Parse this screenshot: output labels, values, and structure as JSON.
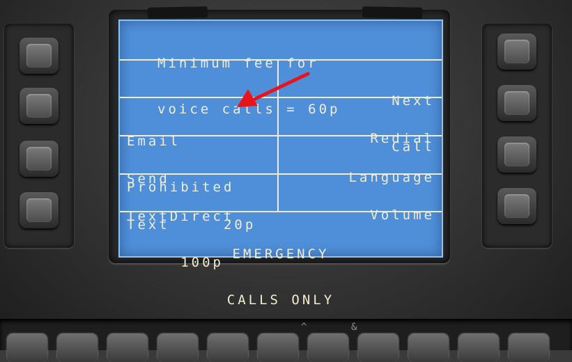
{
  "screen": {
    "fee_line1": "Minimum fee for",
    "fee_line2": "voice calls = 60p",
    "rows": [
      {
        "left": [
          "",
          ""
        ],
        "right": [
          "Next",
          "Call"
        ]
      },
      {
        "left": [
          "Email",
          "Prohibited"
        ],
        "right": [
          "Redial",
          ""
        ]
      },
      {
        "left": [
          "Send",
          "Text     20p"
        ],
        "right": [
          "Language",
          ""
        ]
      },
      {
        "left": [
          "TextDirect",
          "     100p"
        ],
        "right": [
          "Volume",
          ""
        ]
      }
    ],
    "emergency_line1": "EMERGENCY",
    "emergency_line2": "CALLS ONLY"
  },
  "keypad_symbols": [
    "^",
    "&"
  ],
  "colors": {
    "screen_bg": "#4f8fda",
    "screen_text": "#f2ecd0",
    "annotation_arrow": "#e8141c"
  },
  "icons": {
    "annotation": "red-arrow-icon"
  }
}
